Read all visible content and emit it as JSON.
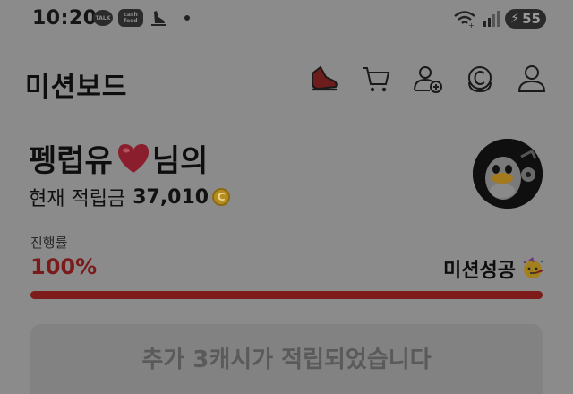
{
  "status_bar": {
    "time": "10:20",
    "talk_badge": "TALK",
    "cashfeed_badge_line1": "cash",
    "cashfeed_badge_line2": "feed",
    "battery": "55"
  },
  "header": {
    "title": "미션보드",
    "icons": [
      "shoe-icon",
      "cart-icon",
      "add-user-icon",
      "coin-c-icon",
      "profile-icon"
    ]
  },
  "profile": {
    "name_prefix": "펭럽유",
    "name_suffix": "님의",
    "balance_label": "현재 적립금",
    "balance_value": "37,010",
    "coin_symbol": "C"
  },
  "progress": {
    "label": "진행률",
    "value_text": "100%",
    "fraction": 1.0,
    "status_text": "미션성공"
  },
  "action": {
    "label": "추가 3캐시가 적립되었습니다"
  },
  "colors": {
    "overlay_bg": "#8b8b8b",
    "progress_red": "#7e1b1b",
    "heart_red": "#8a1e2c",
    "coin_gold": "#b58d1e"
  }
}
